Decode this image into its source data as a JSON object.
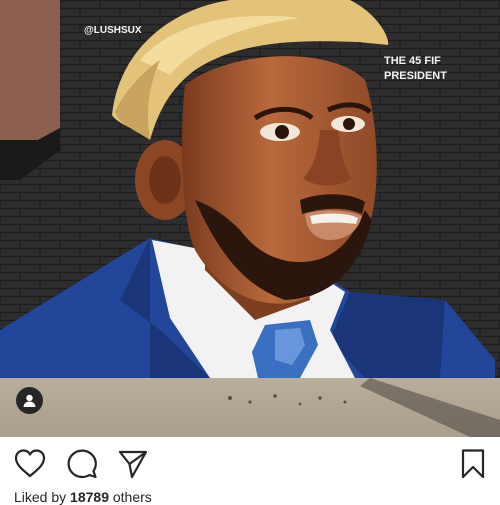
{
  "post": {
    "image": {
      "artist_handle": "@LUSHSUX",
      "caption_line1": "THE 45 FIF",
      "caption_line2": "PRESIDENT"
    },
    "tag_icon": "person-icon",
    "actions": {
      "like_icon": "heart-icon",
      "comment_icon": "comment-icon",
      "share_icon": "send-icon",
      "save_icon": "bookmark-icon"
    },
    "likes": {
      "prefix": "Liked by ",
      "count": "18789",
      "suffix": " others"
    }
  },
  "colors": {
    "brick": "#2b2b2b",
    "skin": "#a45a33",
    "hair": "#e3c27a",
    "suit": "#22469a",
    "tie": "#3a6fc2",
    "icon": "#262626"
  }
}
